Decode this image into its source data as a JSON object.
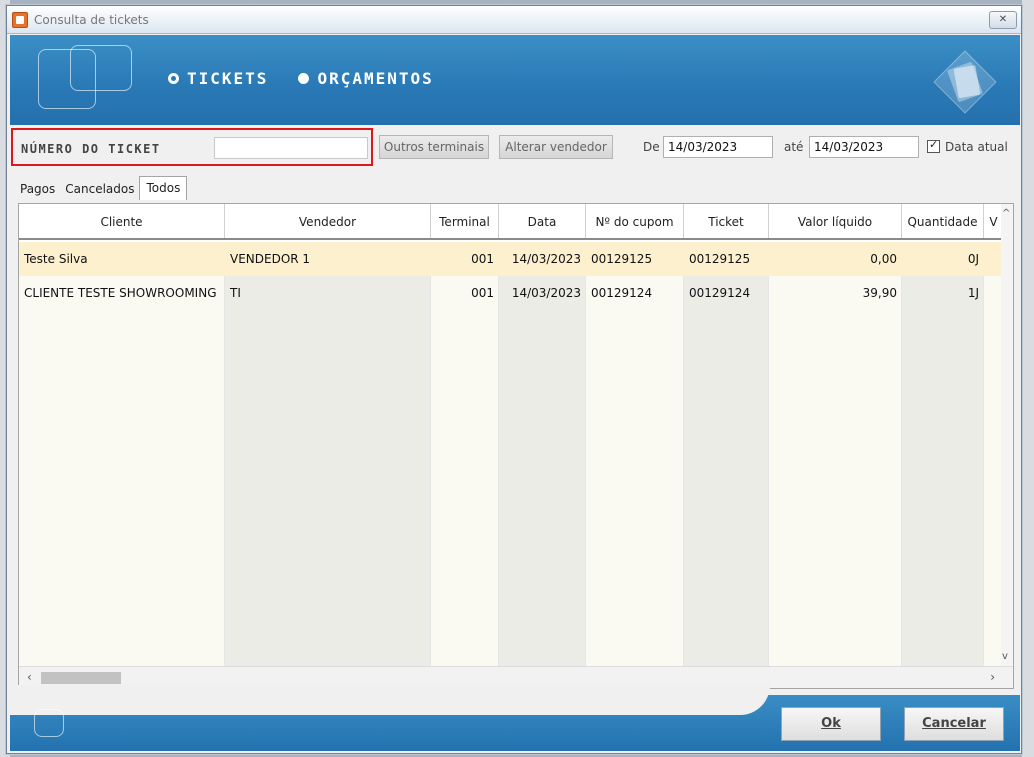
{
  "window": {
    "title": "Consulta de tickets",
    "close_icon": "close-icon"
  },
  "header": {
    "options": [
      {
        "label": "Tickets",
        "checked": true
      },
      {
        "label": "Orçamentos",
        "checked": false
      }
    ],
    "brand_color": "#2a7ab7"
  },
  "filters": {
    "ticket_label": "Número do ticket",
    "ticket_value": "",
    "other_terminals_label": "Outros terminais",
    "change_seller_label": "Alterar vendedor",
    "from_label": "De",
    "from_value": "14/03/2023",
    "to_label": "até",
    "to_value": "14/03/2023",
    "current_date_label": "Data atual",
    "current_date_checked": true,
    "highlight_color": "#e0161d"
  },
  "tabs": [
    {
      "label": "Pagos",
      "active": false
    },
    {
      "label": "Cancelados",
      "active": false
    },
    {
      "label": "Todos",
      "active": true
    }
  ],
  "grid": {
    "columns": [
      "Cliente",
      "Vendedor",
      "Terminal",
      "Data",
      "Nº do cupom",
      "Ticket",
      "Valor líquido",
      "Quantidade",
      "V"
    ],
    "rows": [
      {
        "cliente": "Teste Silva",
        "vendedor": "VENDEDOR 1",
        "terminal": "001",
        "data": "14/03/2023",
        "cupom": "00129125",
        "ticket": "00129125",
        "valor": "0,00",
        "quantidade": "0J",
        "selected": true
      },
      {
        "cliente": "CLIENTE TESTE SHOWROOMING",
        "vendedor": "TI",
        "terminal": "001",
        "data": "14/03/2023",
        "cupom": "00129124",
        "ticket": "00129124",
        "valor": "39,90",
        "quantidade": "1J",
        "selected": false
      }
    ]
  },
  "footer": {
    "ok_label": "Ok",
    "cancel_label": "Cancelar"
  }
}
